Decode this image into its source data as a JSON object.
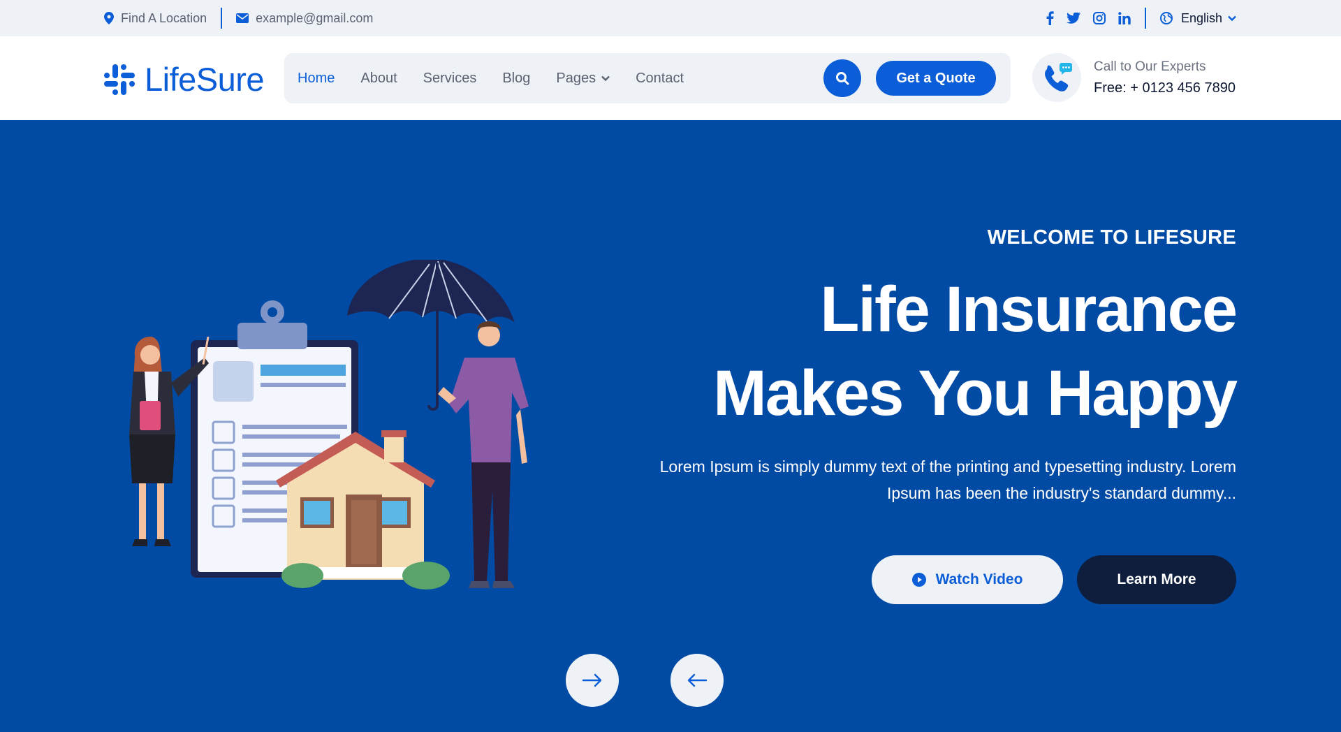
{
  "topbar": {
    "location": "Find A Location",
    "email": "example@gmail.com",
    "social": [
      "facebook-icon",
      "twitter-icon",
      "instagram-icon",
      "linkedin-icon"
    ],
    "language": "English"
  },
  "header": {
    "logo": "LifeSure",
    "nav": [
      {
        "label": "Home",
        "active": true
      },
      {
        "label": "About"
      },
      {
        "label": "Services"
      },
      {
        "label": "Blog"
      },
      {
        "label": "Pages",
        "dropdown": true
      },
      {
        "label": "Contact"
      }
    ],
    "quote_button": "Get a Quote",
    "call_label": "Call to Our Experts",
    "call_number": "Free: + 0123 456 7890"
  },
  "hero": {
    "kicker": "WELCOME TO LIFESURE",
    "title_line1": "Life Insurance",
    "title_line2": "Makes You Happy",
    "desc_line1": "Lorem Ipsum is simply dummy text of the printing and typesetting industry. Lorem",
    "desc_line2": "Ipsum has been the industry's standard dummy...",
    "watch_button": "Watch Video",
    "learn_button": "Learn More"
  },
  "colors": {
    "primary": "#0b5ed7",
    "hero_bg": "#024ba4",
    "dark": "#0f1e3d",
    "light": "#eef2f7"
  }
}
